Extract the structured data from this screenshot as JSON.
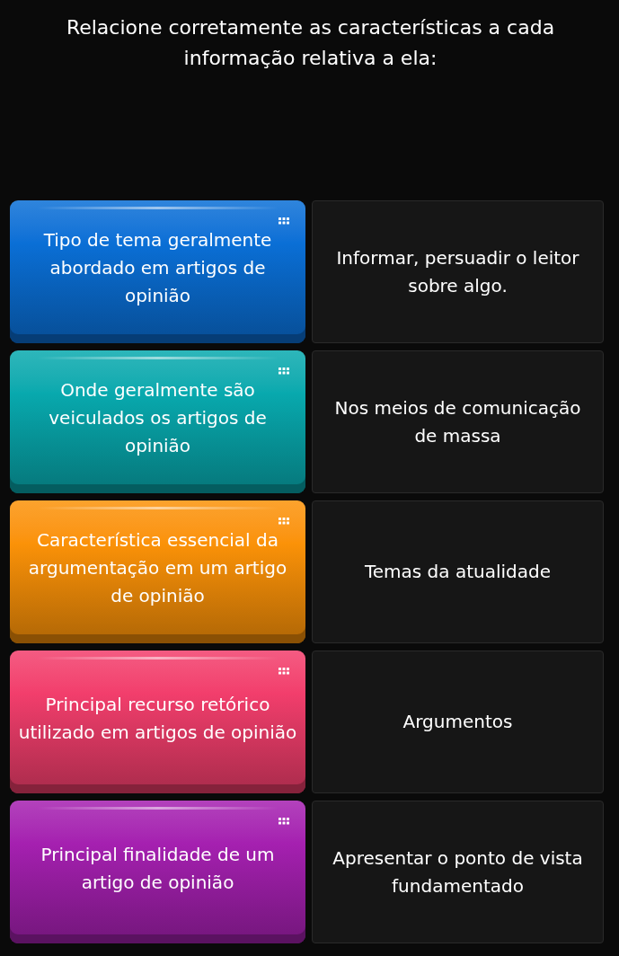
{
  "question": "Relacione corretamente as características a cada informação relativa a ela:",
  "pairs": [
    {
      "prompt": "Tipo de tema geralmente abordado em artigos de opinião",
      "color": "#0a6fd6",
      "answer": "Informar, persuadir o leitor sobre algo."
    },
    {
      "prompt": "Onde geralmente são veiculados os artigos de opinião",
      "color": "#08a9ae",
      "answer": "Nos meios de comunicação de massa"
    },
    {
      "prompt": "Característica essencial da argumentação em um artigo de opinião",
      "color": "#fb9208",
      "answer": "Temas da atualidade"
    },
    {
      "prompt": "Principal recurso retórico utilizado em artigos de opinião",
      "color": "#f23e6c",
      "answer": "Argumentos"
    },
    {
      "prompt": "Principal finalidade de um artigo de opinião",
      "color": "#a520b0",
      "answer": "Apresentar o ponto de vista fundamentado"
    }
  ]
}
